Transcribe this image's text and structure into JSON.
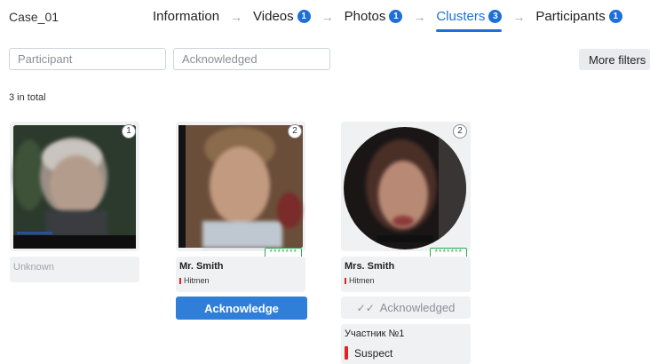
{
  "header": {
    "case_name": "Case_01",
    "steps": [
      {
        "label": "Information",
        "badge": null
      },
      {
        "label": "Videos",
        "badge": "1"
      },
      {
        "label": "Photos",
        "badge": "1"
      },
      {
        "label": "Clusters",
        "badge": "3"
      },
      {
        "label": "Participants",
        "badge": "1"
      }
    ],
    "active_step": "Clusters",
    "separator": "→"
  },
  "filters": {
    "participant_placeholder": "Participant",
    "acknowledged_placeholder": "Acknowledged",
    "more_filters_label": "More filters"
  },
  "summary": {
    "total_label": "3 in total"
  },
  "clusters": [
    {
      "count": "1",
      "name": "Unknown",
      "group": "",
      "acknowledged": false
    },
    {
      "count": "2",
      "name": "Mr. Smith",
      "group": "Hitmen",
      "acknowledged": false,
      "pin": "*******",
      "action_label": "Acknowledge"
    },
    {
      "count": "2",
      "name": "Mrs. Smith",
      "group": "Hitmen",
      "acknowledged": true,
      "pin": "*******",
      "status_label": "Acknowledged",
      "participant_label": "Участник №1",
      "role_label": "Suspect"
    }
  ],
  "colors": {
    "accent": "#1f6fd8",
    "button": "#2f7fd9",
    "tag_red": "#e02424",
    "pin_green": "#2fa84f"
  }
}
